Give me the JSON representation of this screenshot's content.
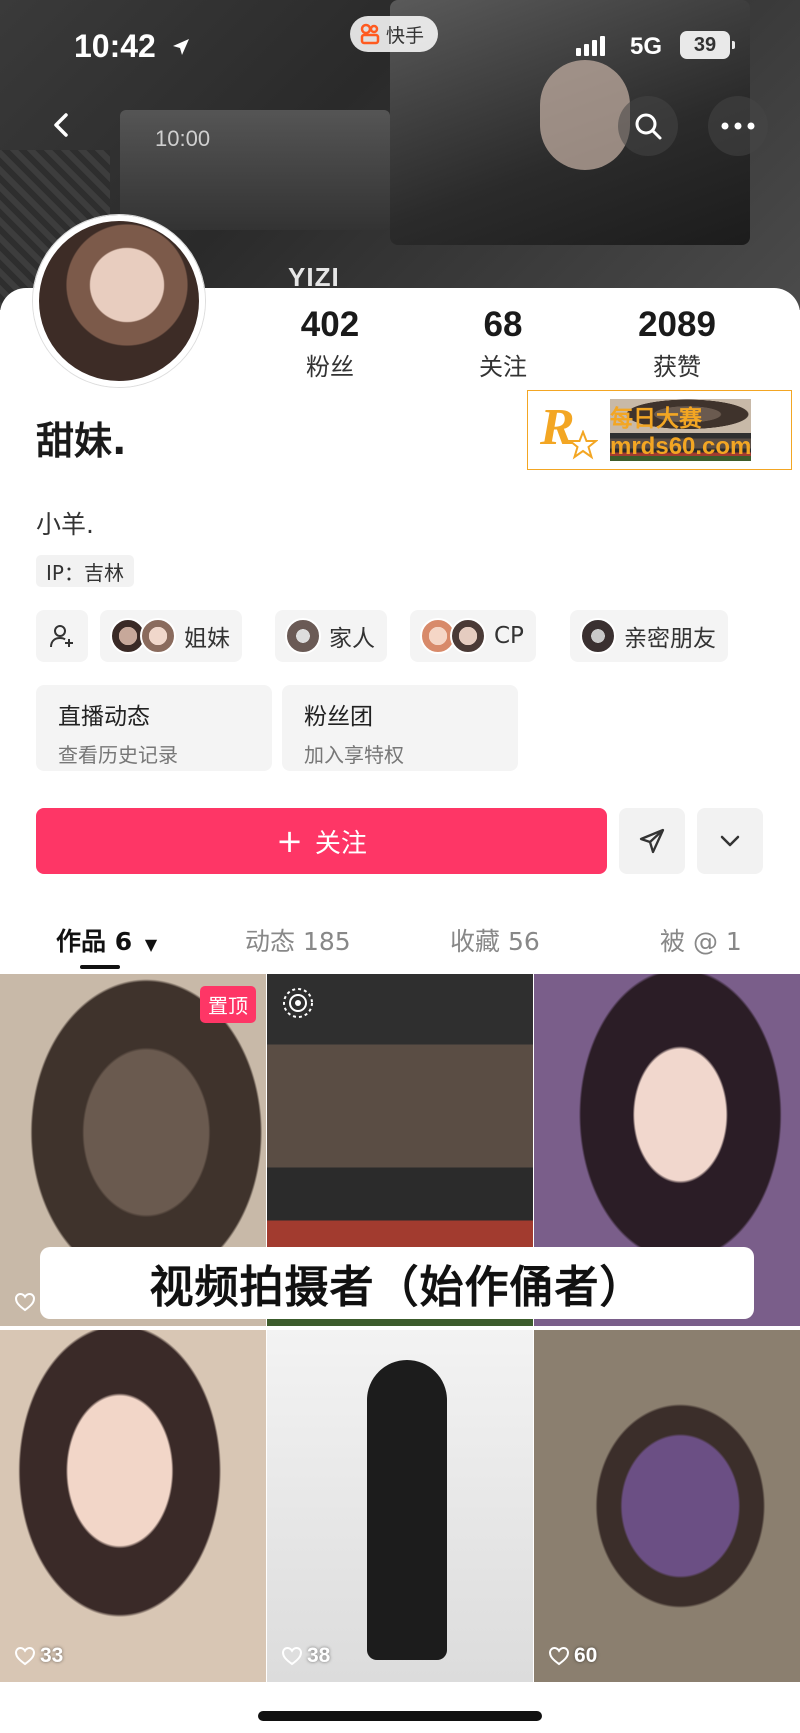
{
  "status_bar": {
    "time": "10:42",
    "network": "5G",
    "battery": "39",
    "app_name": "快手"
  },
  "banner": {
    "inner_time": "10:00",
    "overlay_text": "YIZI"
  },
  "profile": {
    "stats": [
      {
        "value": "402",
        "label": "粉丝"
      },
      {
        "value": "68",
        "label": "关注"
      },
      {
        "value": "2089",
        "label": "获赞"
      }
    ],
    "name": "甜妹.",
    "bio": "小羊.",
    "ip": "IP：吉林",
    "relations": [
      {
        "label": "姐妹"
      },
      {
        "label": "家人"
      },
      {
        "label": "CP"
      },
      {
        "label": "亲密朋友"
      }
    ],
    "info_cards": [
      {
        "title": "直播动态",
        "subtitle": "查看历史记录"
      },
      {
        "title": "粉丝团",
        "subtitle": "加入享特权"
      }
    ],
    "follow_label": "关注"
  },
  "watermark": {
    "line1": "每日大赛",
    "line2": "mrds60.com",
    "mark": "R"
  },
  "tabs": [
    {
      "label": "作品 6",
      "active": true
    },
    {
      "label": "动态 185",
      "active": false
    },
    {
      "label": "收藏 56",
      "active": false
    },
    {
      "label": "被 @ 1",
      "active": false
    }
  ],
  "grid": {
    "pinned_label": "置顶",
    "tiles": [
      {
        "likes": ""
      },
      {
        "likes": ""
      },
      {
        "likes": ""
      },
      {
        "likes": "33"
      },
      {
        "likes": "38"
      },
      {
        "likes": "60"
      }
    ]
  },
  "caption": "视频拍摄者（始作俑者）",
  "colors": {
    "accent": "#fe3666",
    "watermark": "#f3a623"
  },
  "icons": [
    "back-icon",
    "search-icon",
    "more-icon",
    "add-friend-icon",
    "share-icon",
    "chevron-down-icon",
    "heart-icon",
    "live-icon"
  ]
}
